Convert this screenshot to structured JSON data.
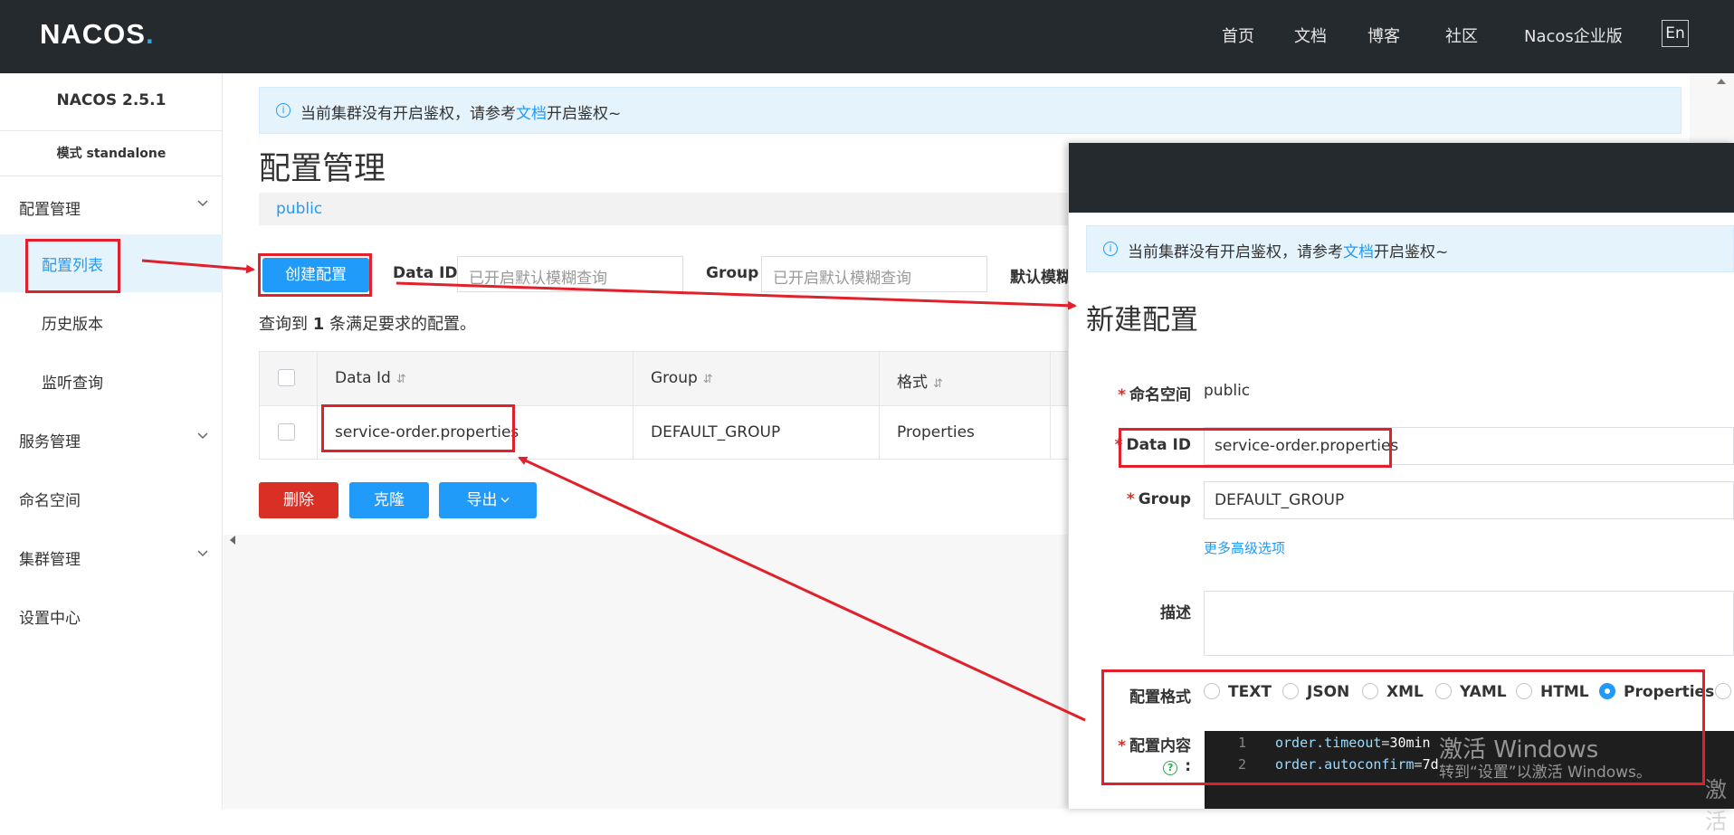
{
  "topbar": {
    "logo_text": "NACOS",
    "logo_dot": ".",
    "nav": [
      "首页",
      "文档",
      "博客",
      "社区",
      "Nacos企业版"
    ],
    "lang": "En"
  },
  "sidebar": {
    "version": "NACOS 2.5.1",
    "mode": "模式 standalone",
    "items": [
      {
        "label": "配置管理"
      },
      {
        "label": "配置列表"
      },
      {
        "label": "历史版本"
      },
      {
        "label": "监听查询"
      },
      {
        "label": "服务管理"
      },
      {
        "label": "命名空间"
      },
      {
        "label": "集群管理"
      },
      {
        "label": "设置中心"
      }
    ]
  },
  "notice": {
    "prefix": "当前集群没有开启鉴权，请参考",
    "link": "文档",
    "suffix": "开启鉴权~"
  },
  "main": {
    "title": "配置管理",
    "namespace": "public",
    "create_button": "创建配置",
    "data_id_label": "Data ID",
    "data_id_placeholder": "已开启默认模糊查询",
    "group_label": "Group",
    "group_placeholder": "已开启默认模糊查询",
    "fuzzy_label": "默认模糊",
    "result_prefix": "查询到",
    "result_count": "1",
    "result_suffix": "条满足要求的配置。",
    "table": {
      "headers": [
        "Data Id",
        "Group",
        "格式"
      ],
      "sort_glyph": "⇵",
      "rows": [
        {
          "data_id": "service-order.properties",
          "group": "DEFAULT_GROUP",
          "format": "Properties"
        }
      ]
    },
    "delete_button": "删除",
    "clone_button": "克隆",
    "export_button": "导出"
  },
  "dialog": {
    "notice_prefix": "当前集群没有开启鉴权，请参考",
    "notice_link": "文档",
    "notice_suffix": "开启鉴权~",
    "title": "新建配置",
    "namespace_label": "命名空间",
    "namespace_value": "public",
    "data_id_label": "Data ID",
    "data_id_value": "service-order.properties",
    "group_label": "Group",
    "group_value": "DEFAULT_GROUP",
    "advanced_link": "更多高级选项",
    "desc_label": "描述",
    "format_label": "配置格式",
    "formats": [
      "TEXT",
      "JSON",
      "XML",
      "YAML",
      "HTML",
      "Properties"
    ],
    "selected_format": "Properties",
    "content_label": "配置内容",
    "content_colon": ":",
    "code_lines": [
      {
        "num": "1",
        "key": "order.timeout",
        "value": "30min"
      },
      {
        "num": "2",
        "key": "order.autoconfirm",
        "value": "7d"
      }
    ]
  },
  "watermark": {
    "line1": "激活 Windows",
    "line2": "转到“设置”以激活 Windows。",
    "edge": "激活"
  },
  "colors": {
    "topbar": "#252a2f",
    "accent": "#209bfa",
    "danger": "#d93026",
    "annotation": "#e0202b"
  }
}
